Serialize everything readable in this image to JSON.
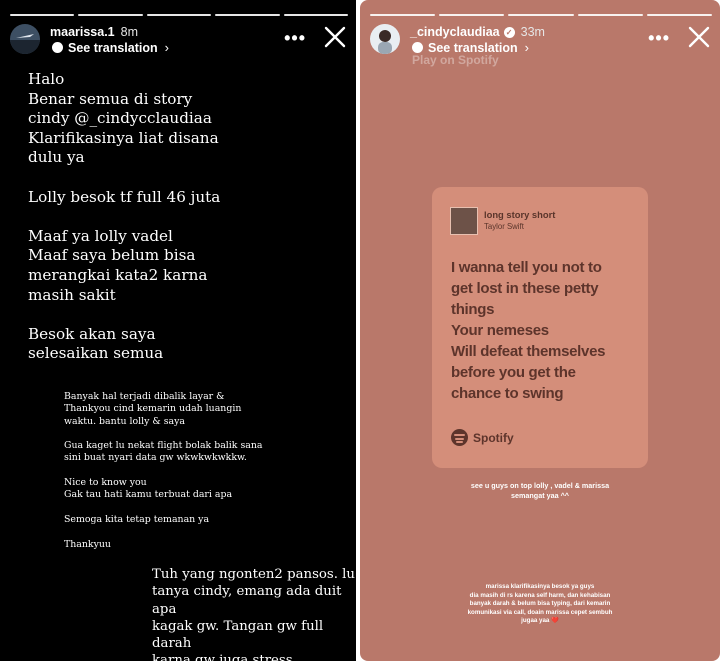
{
  "left_story": {
    "username": "maarissa.1",
    "time": "8m",
    "see_translation": "See translation",
    "text_block_1": "Halo\nBenar semua di story\ncindy @_cindycclaudiaa\nKlarifikasinya liat disana\ndulu ya\n\nLolly besok tf full 46 juta\n\nMaaf ya lolly vadel\nMaaf saya belum bisa\nmerangkai kata2 karna\nmasih sakit\n\nBesok akan saya\nselesaikan semua",
    "text_block_2": "Banyak hal terjadi dibalik layar &\nThankyou cind kemarin udah luangin\nwaktu. bantu lolly & saya\n\nGua kaget lu nekat flight bolak balik sana\nsini buat nyari data gw wkwkwkwkkw.\n\nNice to know you\nGak tau hati kamu terbuat dari apa\n\nSemoga kita tetap temanan ya\n\nThankyuu",
    "text_block_3": "Tuh yang ngonten2 pansos. lu\ntanya cindy, emang ada duit apa\nkagak gw. Tangan gw full darah\nkarna gw juga stress"
  },
  "right_story": {
    "username": "_cindyclaudiaa",
    "time": "33m",
    "see_translation": "See translation",
    "faded_label": "Play on Spotify",
    "song_title": "long story short",
    "artist": "Taylor Swift",
    "lyrics": "I wanna tell you not to\nget lost in these petty\nthings\nYour nemeses\nWill defeat themselves\nbefore you get the\nchance to swing",
    "spotify_label": "Spotify",
    "caption_1": "see u guys on top lolly , vadel & marissa\nsemangat yaa ^^",
    "caption_2": "marissa klarifikasinya besok ya guys\ndia masih di rs karena self harm, dan kehabisan\nbanyak darah & belum bisa typing, dari kemarin\nkomunikasi via call, doain marissa cepet sembuh\njugaa yaa ❤️"
  },
  "colors": {
    "left_bg": "#000000",
    "right_bg": "#b9786a",
    "card_bg": "#d48e7a",
    "lyrics_text": "#5d342b"
  },
  "icons": [
    "translate-icon",
    "more-icon",
    "close-icon",
    "verified-icon",
    "spotify-icon"
  ]
}
